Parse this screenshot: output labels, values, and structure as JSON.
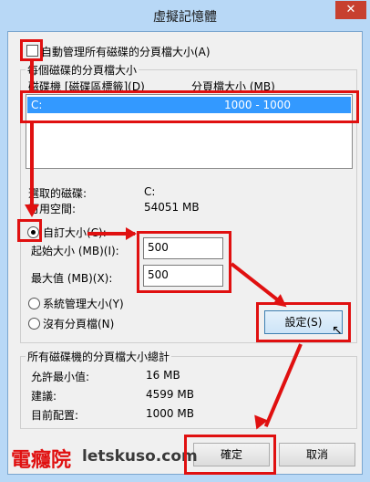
{
  "window": {
    "title": "虛擬記憶體",
    "close_glyph": "✕"
  },
  "auto_manage": {
    "label": "自動管理所有磁碟的分頁檔大小(A)",
    "checked": false
  },
  "per_drive": {
    "group_label": "每個磁碟的分頁檔大小",
    "col_drive": "磁碟機 [磁碟區標籤](D)",
    "col_size": "分頁檔大小 (MB)",
    "rows": [
      {
        "drive": "C:",
        "size": "1000 - 1000",
        "selected": true
      }
    ]
  },
  "selected_drive": {
    "label": "選取的磁碟:",
    "value": "C:",
    "space_label": "可用空間:",
    "space_value": "54051 MB"
  },
  "custom_size": {
    "label": "自訂大小(C):",
    "checked": true,
    "initial_label": "起始大小 (MB)(I):",
    "initial_value": "500",
    "max_label": "最大值 (MB)(X):",
    "max_value": "500"
  },
  "system_managed": {
    "label": "系統管理大小(Y)",
    "checked": false
  },
  "no_paging": {
    "label": "沒有分頁檔(N)",
    "checked": false
  },
  "set_button": "設定(S)",
  "totals": {
    "group_label": "所有磁碟機的分頁檔大小總計",
    "min_label": "允許最小值:",
    "min_value": "16 MB",
    "rec_label": "建議:",
    "rec_value": "4599 MB",
    "cur_label": "目前配置:",
    "cur_value": "1000 MB"
  },
  "buttons": {
    "ok": "確定",
    "cancel": "取消"
  },
  "watermark": {
    "cn": "電癮院",
    "en": "letskuso.com"
  },
  "colors": {
    "titlebar": "#b8d8f6",
    "close": "#c7402f",
    "selection": "#3399ff",
    "annotation": "#e01010"
  }
}
